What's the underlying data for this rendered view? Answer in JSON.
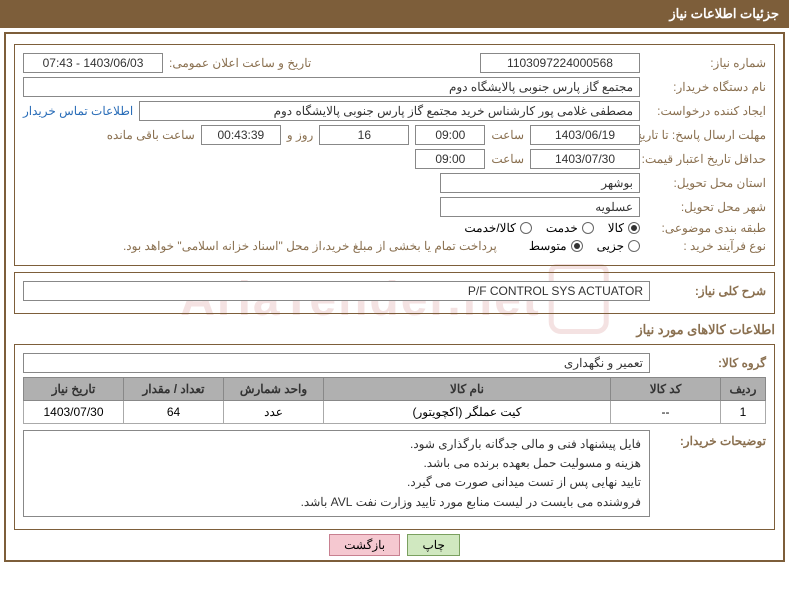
{
  "header": {
    "title": "جزئیات اطلاعات نیاز"
  },
  "fields": {
    "need_no_label": "شماره نیاز:",
    "need_no": "1103097224000568",
    "announce_label": "تاریخ و ساعت اعلان عمومی:",
    "announce_value": "1403/06/03 - 07:43",
    "buyer_label": "نام دستگاه خریدار:",
    "buyer_value": "مجتمع گاز پارس جنوبی  پالایشگاه دوم",
    "requester_label": "ایجاد کننده درخواست:",
    "requester_value": "مصطفی غلامی پور کارشناس خرید مجتمع گاز پارس جنوبی  پالایشگاه دوم",
    "contact_link": "اطلاعات تماس خریدار",
    "resp_deadline_label": "مهلت ارسال پاسخ: تا تاریخ:",
    "resp_date": "1403/06/19",
    "time_label": "ساعت",
    "resp_time": "09:00",
    "days_val": "16",
    "days_and": "روز و",
    "countdown": "00:43:39",
    "remain_label": "ساعت باقی مانده",
    "validity_label": "حداقل تاریخ اعتبار قیمت: تا تاریخ:",
    "validity_date": "1403/07/30",
    "validity_time": "09:00",
    "province_label": "استان محل تحویل:",
    "province_value": "بوشهر",
    "city_label": "شهر محل تحویل:",
    "city_value": "عسلویه",
    "category_label": "طبقه بندی موضوعی:",
    "cat_kala": "کالا",
    "cat_khadamat": "خدمت",
    "cat_both": "کالا/خدمت",
    "process_label": "نوع فرآیند خرید :",
    "proc_jozi": "جزیی",
    "proc_motavaset": "متوسط",
    "payment_note": "پرداخت تمام یا بخشی از مبلغ خرید،از محل \"اسناد خزانه اسلامی\" خواهد بود.",
    "summary_label": "شرح کلی نیاز:",
    "summary_value": "P/F CONTROL SYS ACTUATOR",
    "goods_info_title": "اطلاعات کالاهای مورد نیاز",
    "group_label": "گروه کالا:",
    "group_value": "تعمیر و نگهداری",
    "buyer_desc_label": "توضیحات خریدار:",
    "buyer_desc_l1": "فایل پیشنهاد فنی و مالی جدگانه بارگذاری شود.",
    "buyer_desc_l2": "هزینه و مسولیت حمل بعهده برنده می باشد.",
    "buyer_desc_l3": "تایید نهایی پس از تست میدانی صورت می گیرد.",
    "buyer_desc_l4": "فروشنده می بایست در لیست منابع مورد تایید وزارت نفت AVL باشد."
  },
  "table": {
    "headers": {
      "row": "ردیف",
      "code": "کد کالا",
      "name": "نام کالا",
      "unit": "واحد شمارش",
      "qty": "تعداد / مقدار",
      "date": "تاریخ نیاز"
    },
    "rows": [
      {
        "row": "1",
        "code": "--",
        "name": "کیت عملگر (اکچویتور)",
        "unit": "عدد",
        "qty": "64",
        "date": "1403/07/30"
      }
    ]
  },
  "buttons": {
    "print": "چاپ",
    "back": "بازگشت"
  },
  "watermark": "AriaTender.net"
}
